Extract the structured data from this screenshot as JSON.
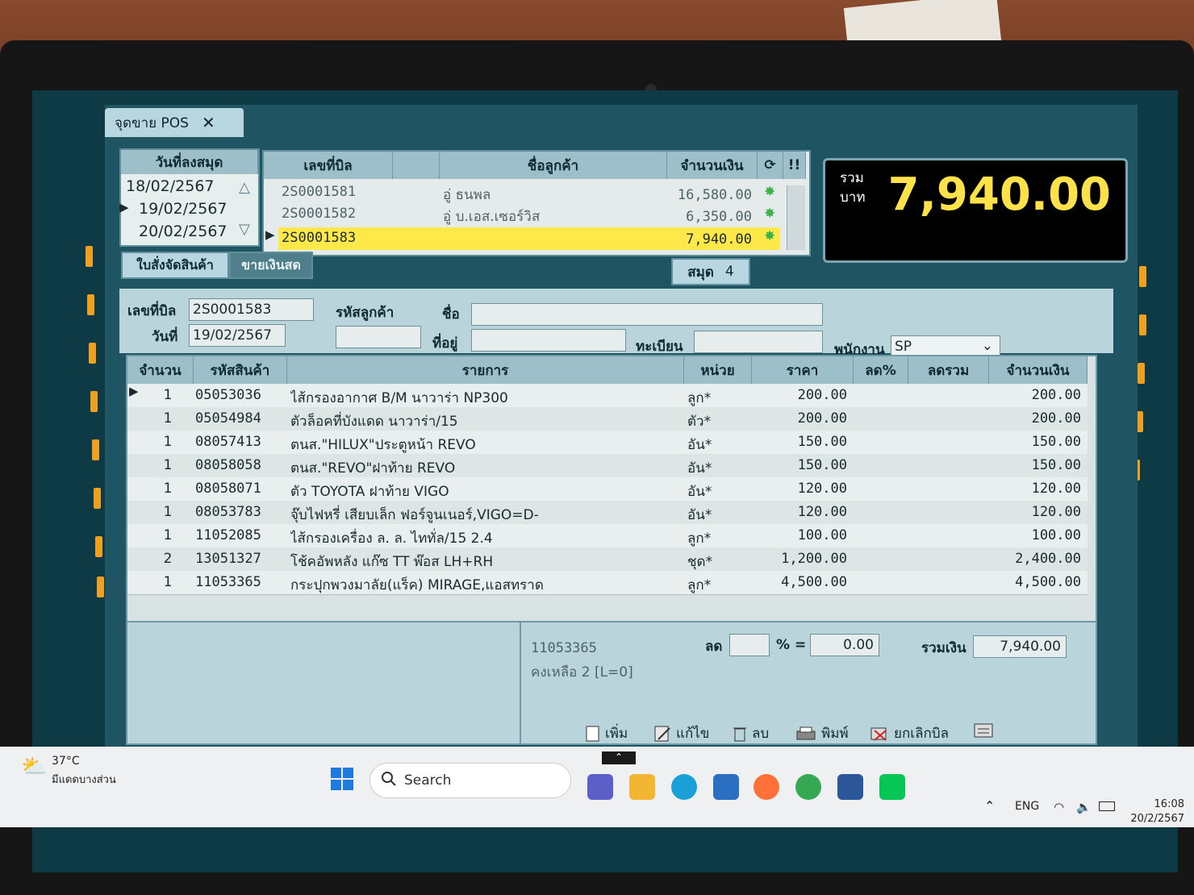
{
  "window": {
    "tab_title": "จุดขาย POS",
    "close": "✕"
  },
  "date_list": {
    "header": "วันที่ลงสมุด",
    "items": [
      "18/02/2567",
      "19/02/2567",
      "20/02/2567"
    ],
    "selected_index": 1
  },
  "bill_list": {
    "headers": {
      "bill_no": "เลขที่บิล",
      "customer": "ชื่อลูกค้า",
      "amount": "จำนวนเงิน"
    },
    "rows": [
      {
        "bill_no": "2S0001581",
        "customer": "อู่ ธนพล",
        "amount": "16,580.00"
      },
      {
        "bill_no": "2S0001582",
        "customer": "อู่ บ.เอส.เซอร์วิส",
        "amount": "6,350.00"
      },
      {
        "bill_no": "2S0001583",
        "customer": "",
        "amount": "7,940.00"
      }
    ],
    "selected_index": 2
  },
  "subtabs": {
    "order": "ใบสั่งจัดสินค้า",
    "cash_sale": "ขายเงินสด"
  },
  "book": {
    "label": "สมุด",
    "value": "4"
  },
  "total_display": {
    "label_line1": "รวม",
    "label_line2": "บาท",
    "amount": "7,940.00"
  },
  "form": {
    "bill_no_label": "เลขที่บิล",
    "bill_no": "2S0001583",
    "date_label": "วันที่",
    "date": "19/02/2567",
    "customer_code_label": "รหัสลูกค้า",
    "customer_code": "",
    "name_label": "ชื่อ",
    "name": "",
    "address_label": "ที่อยู่",
    "address": "",
    "reg_label": "ทะเบียน",
    "reg": "",
    "staff_label": "พนักงาน",
    "staff": "SP"
  },
  "grid": {
    "headers": {
      "qty": "จำนวน",
      "code": "รหัสสินค้า",
      "desc": "รายการ",
      "unit": "หน่วย",
      "price": "ราคา",
      "disc_pct": "ลด%",
      "disc_total": "ลดรวม",
      "amount": "จำนวนเงิน"
    },
    "rows": [
      {
        "qty": "1",
        "code": "05053036",
        "desc": "ไส้กรองอากาศ B/M นาวาร่า NP300",
        "unit": "ลูก*",
        "price": "200.00",
        "amount": "200.00"
      },
      {
        "qty": "1",
        "code": "05054984",
        "desc": "ตัวล็อคที่บังแดด นาวาร่า/15",
        "unit": "ตัว*",
        "price": "200.00",
        "amount": "200.00"
      },
      {
        "qty": "1",
        "code": "08057413",
        "desc": "ตนส.\"HILUX\"ประตูหน้า REVO",
        "unit": "อัน*",
        "price": "150.00",
        "amount": "150.00"
      },
      {
        "qty": "1",
        "code": "08058058",
        "desc": "ตนส.\"REVO\"ฝาท้าย REVO",
        "unit": "อัน*",
        "price": "150.00",
        "amount": "150.00"
      },
      {
        "qty": "1",
        "code": "08058071",
        "desc": "ตัว TOYOTA ฝาท้าย VIGO",
        "unit": "อัน*",
        "price": "120.00",
        "amount": "120.00"
      },
      {
        "qty": "1",
        "code": "08053783",
        "desc": "จุ๊บไฟหรี่ เสียบเล็ก ฟอร์จูนเนอร์,VIGO=D-",
        "unit": "อัน*",
        "price": "120.00",
        "amount": "120.00"
      },
      {
        "qty": "1",
        "code": "11052085",
        "desc": "ไส้กรองเครื่อง ล. ล. ไททั่ล/15 2.4",
        "unit": "ลูก*",
        "price": "100.00",
        "amount": "100.00"
      },
      {
        "qty": "2",
        "code": "13051327",
        "desc": "โช้คอัพหลัง แก๊ซ TT พ๊อส LH+RH",
        "unit": "ชุด*",
        "price": "1,200.00",
        "amount": "2,400.00"
      },
      {
        "qty": "1",
        "code": "11053365",
        "desc": "กระปุกพวงมาลัย(แร็ค) MIRAGE,แอสทราด",
        "unit": "ลูก*",
        "price": "4,500.00",
        "amount": "4,500.00"
      }
    ]
  },
  "footer": {
    "item_code": "11053365",
    "remaining": "คงเหลือ 2 [L=0]",
    "discount_label": "ลด",
    "discount_pct": "",
    "percent_eq": "% =",
    "discount_value": "0.00",
    "sum_label": "รวมเงิน",
    "sum_value": "7,940.00",
    "buttons": {
      "add": "เพิ่ม",
      "edit": "แก้ไข",
      "delete": "ลบ",
      "print": "พิมพ์",
      "cancel": "ยกเลิกบิล"
    }
  },
  "taskbar": {
    "weather_temp": "37°C",
    "weather_desc": "มีแดดบางส่วน",
    "search": "Search",
    "lang": "ENG",
    "time": "16:08",
    "date": "20/2/2567"
  }
}
